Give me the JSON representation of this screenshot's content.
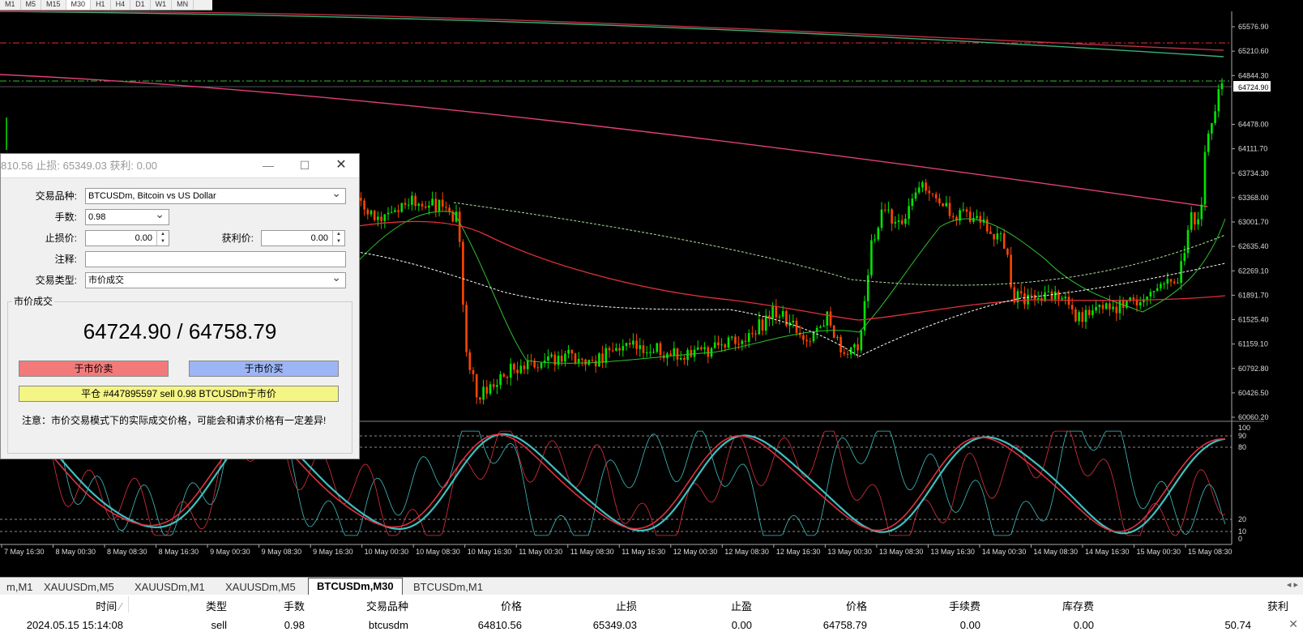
{
  "timeframes": [
    "M1",
    "M5",
    "M15",
    "M30",
    "H1",
    "H4",
    "D1",
    "W1",
    "MN"
  ],
  "price_scale": [
    "65576.90",
    "65210.60",
    "64844.30",
    "64724.90",
    "64478.00",
    "64111.70",
    "63734.30",
    "63368.00",
    "63001.70",
    "62635.40",
    "62269.10",
    "61891.70",
    "61525.40",
    "61159.10",
    "60792.80",
    "60426.50",
    "60060.20"
  ],
  "osc_scale": [
    "100",
    "90",
    "80",
    "20",
    "10",
    "0"
  ],
  "time_axis": [
    "7 May 16:30",
    "8 May 00:30",
    "8 May 08:30",
    "8 May 16:30",
    "9 May 00:30",
    "9 May 08:30",
    "9 May 16:30",
    "10 May 00:30",
    "10 May 08:30",
    "10 May 16:30",
    "11 May 00:30",
    "11 May 08:30",
    "11 May 16:30",
    "12 May 00:30",
    "12 May 08:30",
    "12 May 16:30",
    "13 May 00:30",
    "13 May 08:30",
    "13 May 16:30",
    "14 May 00:30",
    "14 May 08:30",
    "14 May 16:30",
    "15 May 00:30",
    "15 May 08:30"
  ],
  "colors": {
    "bull": "#00e600",
    "bear": "#ff4500",
    "ma_red": "#e0303a",
    "ma_pink": "#e0407a",
    "ma_green": "#30c030",
    "stoch_main": "#40c0c0",
    "stoch_signal": "#e03040",
    "sell": "#f37a7a",
    "buy": "#9cb5f5",
    "close": "#f5f585"
  },
  "dialog": {
    "title": "810.56 止损: 65349.03 获利: 0.00",
    "symbol_label": "交易品种:",
    "symbol_value": "BTCUSDm, Bitcoin vs US Dollar",
    "lots_label": "手数:",
    "lots_value": "0.98",
    "sl_label": "止损价:",
    "sl_value": "0.00",
    "tp_label": "获利价:",
    "tp_value": "0.00",
    "comment_label": "注释:",
    "comment_value": "",
    "type_label": "交易类型:",
    "type_value": "市价成交",
    "group_label": "市价成交",
    "quote": "64724.90 / 64758.79",
    "sell_btn": "于市价卖",
    "buy_btn": "于市价买",
    "close_btn": "平仓 #447895597 sell 0.98 BTCUSDm于市价",
    "note": "注意：市价交易模式下的实际成交价格，可能会和请求价格有一定差异!"
  },
  "tabs": [
    "m,M1",
    "XAUUSDm,M5",
    "XAUUSDm,M1",
    "XAUUSDm,M5",
    "BTCUSDm,M30",
    "BTCUSDm,M1"
  ],
  "table": {
    "headers": [
      "时间",
      "类型",
      "手数",
      "交易品种",
      "价格",
      "止损",
      "止盈",
      "价格",
      "手续费",
      "库存费",
      "获利"
    ],
    "row": [
      "2024.05.15 15:14:08",
      "sell",
      "0.98",
      "btcusdm",
      "64810.56",
      "65349.03",
      "0.00",
      "64758.79",
      "0.00",
      "0.00",
      "50.74"
    ]
  }
}
